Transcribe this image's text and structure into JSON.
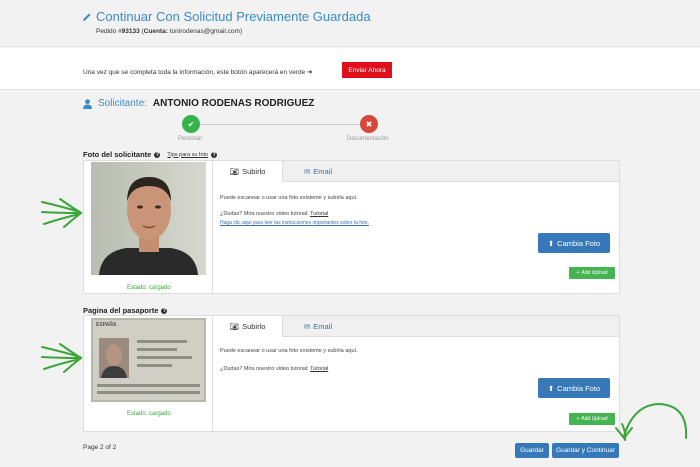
{
  "header": {
    "title": "Continuar Con Solicitud Previamente Guardada",
    "order_label": "Pedido #",
    "order_number": "93133",
    "account_label": "Cuenta:",
    "account_email": "tonirodenas@gmail.com"
  },
  "notice": {
    "text": "Una vez que se completa toda la información, este botón aparecerá en verde",
    "send_button": "Enviar Ahora"
  },
  "applicant": {
    "label": "Solicitante:",
    "name": "ANTONIO RODENAS RODRIGUEZ"
  },
  "steps": [
    {
      "label": "Personal",
      "status": "done"
    },
    {
      "label": "Documentación",
      "status": "error"
    }
  ],
  "photo_section": {
    "title": "Foto del solicitante",
    "tips_link": "Tips para su foto",
    "tabs": [
      "Subirlo",
      "Email"
    ],
    "line1": "Puede escanear o usar una foto existente y subirla aquí.",
    "line2_prefix": "¿Dudas? Mira nuestro video tutorial:",
    "tutorial_link": "Tutorial",
    "instructions_link": "Haga clic aquí para leer las instrucciones importantes sobre la foto.",
    "change_button": "Cambia Foto",
    "add_upload": "Add Upload",
    "status": "Estado: cargado"
  },
  "passport_section": {
    "title": "Pagina del pasaporte",
    "tabs": [
      "Subirlo",
      "Email"
    ],
    "line1": "Puede escanear o usar una foto existente y subirla aquí.",
    "line2_prefix": "¿Dudas? Mira nuestro video tutorial:",
    "tutorial_link": "Tutorial",
    "change_button": "Cambia Foto",
    "add_upload": "Add Upload",
    "status": "Estado: cargado",
    "passport_header": "ESPAÑA"
  },
  "footer": {
    "page": "Page 2 of 2",
    "save_button": "Guardar",
    "save_continue_button": "Guardar y Continuar"
  },
  "colors": {
    "accent": "#3a8bc9",
    "send": "#e0101a",
    "green": "#46b453",
    "annotation": "#3aa63a"
  }
}
